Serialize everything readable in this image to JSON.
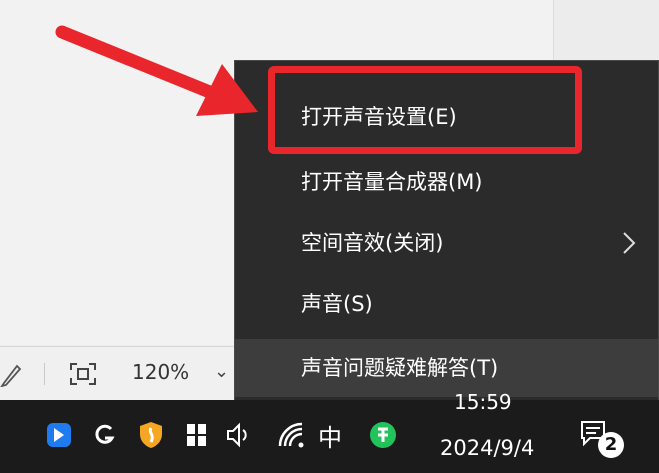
{
  "status_bar": {
    "zoom_value": "120%",
    "zoom_dropdown_icon": "chevron-down-icon"
  },
  "context_menu": {
    "items": [
      {
        "label": "打开声音设置(E)",
        "highlighted": true
      },
      {
        "label": "打开音量合成器(M)"
      },
      {
        "label": "空间音效(关闭)",
        "has_submenu": true
      },
      {
        "label": "声音(S)"
      },
      {
        "label": "声音问题疑难解答(T)",
        "hovered": true
      }
    ]
  },
  "taskbar": {
    "tray_icons": [
      "feishu-icon",
      "g-icon",
      "security-shield-icon",
      "grid-app-icon",
      "speaker-icon",
      "wifi-icon",
      "ime-icon",
      "green-app-icon"
    ],
    "ime_label": "中",
    "time": "15:59",
    "date": "2024/9/4",
    "notification_count": "2"
  },
  "colors": {
    "menu_bg": "#2b2b2b",
    "annotation_red": "#e8262b",
    "taskbar_bg": "#1b1b1b"
  }
}
